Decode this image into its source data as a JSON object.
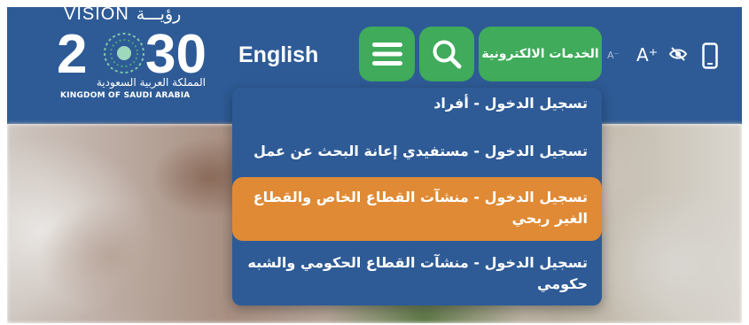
{
  "logo": {
    "vision_en": "VISION",
    "vision_ar": "رؤيـــة",
    "year": "2030",
    "ar_name": "المملكة العربية السعودية",
    "en_name": "KINGDOM OF SAUDI ARABIA"
  },
  "header": {
    "language_link": "English",
    "menu_icon": "hamburger-menu-icon",
    "search_icon": "search-icon",
    "eservices_label": "الخدمات الالكترونية",
    "font_decrease_label": "A⁻",
    "font_increase_label": "A⁺",
    "contrast_icon": "eye-slash-icon",
    "mobile_icon": "mobile-phone-icon"
  },
  "dropdown": {
    "items": [
      {
        "label": "تسجيل الدخول - أفراد"
      },
      {
        "label": "تسجيل الدخول - مستفيدي إعانة البحث عن عمل"
      },
      {
        "label": "تسجيل الدخول - منشآت القطاع الخاص والقطاع الغير ربحي",
        "highlighted": true
      },
      {
        "label": "تسجيل الدخول - منشآت القطاع الحكومي والشبه حكومي"
      }
    ]
  },
  "colors": {
    "header_bg": "#2e5b96",
    "button_green": "#3fab5b",
    "highlight_orange": "#e08a35"
  }
}
